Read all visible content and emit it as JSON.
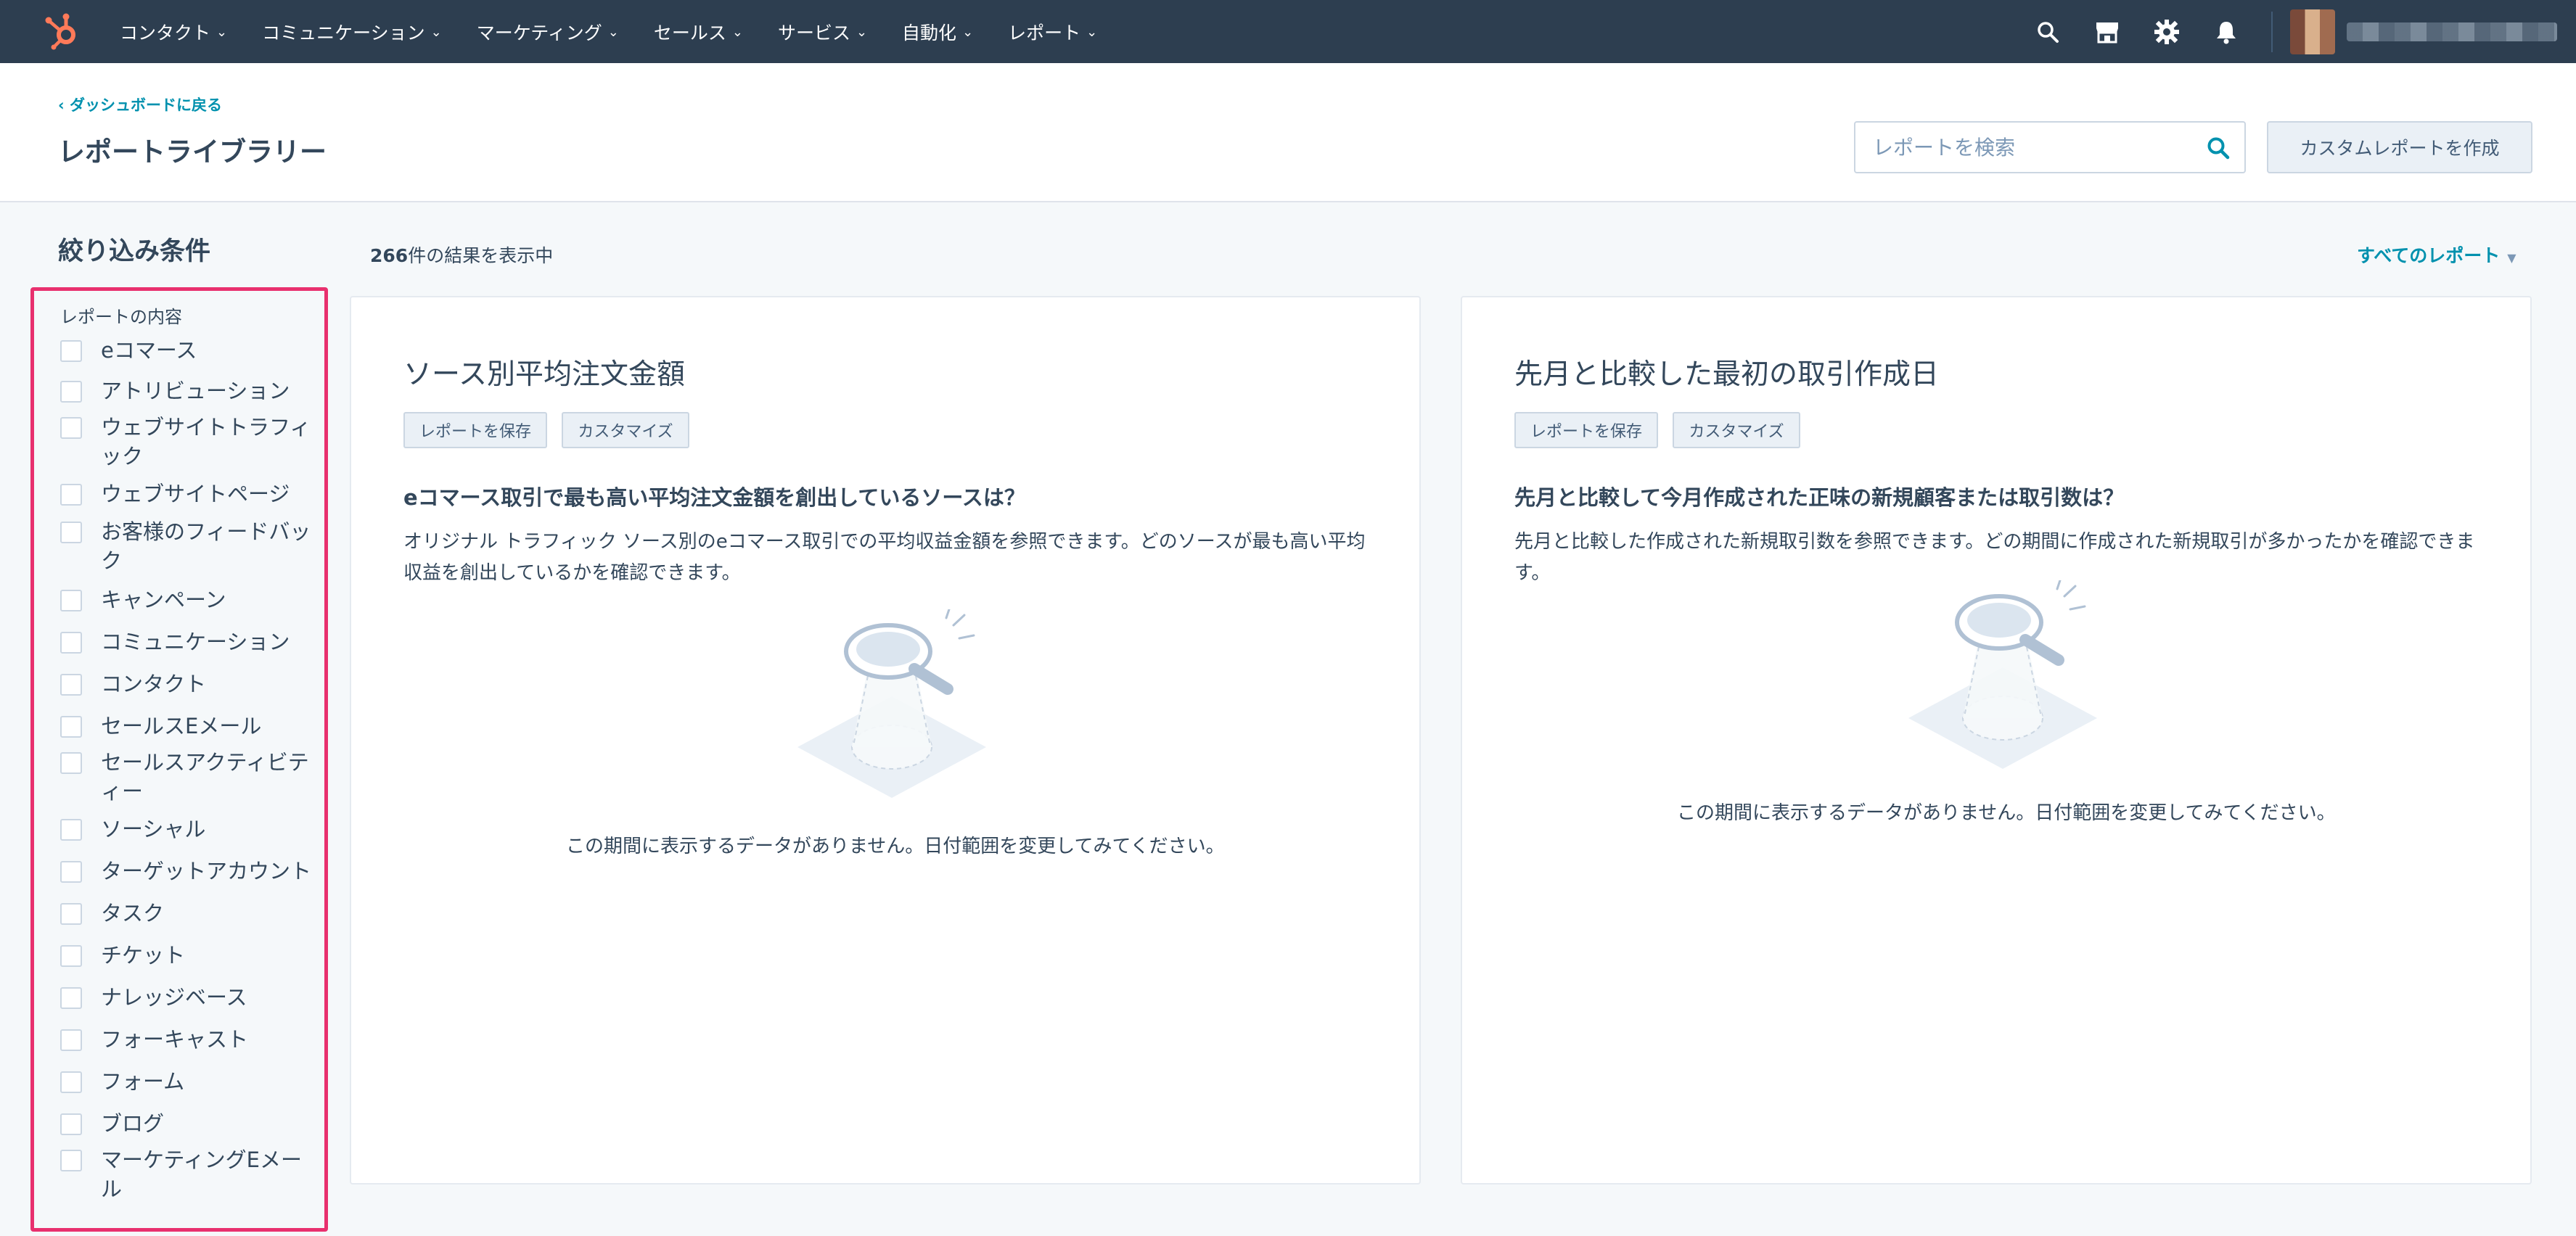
{
  "nav": {
    "items": [
      {
        "label": "コンタクト"
      },
      {
        "label": "コミュニケーション"
      },
      {
        "label": "マーケティング"
      },
      {
        "label": "セールス"
      },
      {
        "label": "サービス"
      },
      {
        "label": "自動化"
      },
      {
        "label": "レポート"
      }
    ],
    "icons": [
      "search-icon",
      "marketplace-icon",
      "gear-icon",
      "bell-icon"
    ]
  },
  "header": {
    "back_link": "ダッシュボードに戻る",
    "title": "レポートライブラリー",
    "search_placeholder": "レポートを検索",
    "create_button": "カスタムレポートを作成"
  },
  "filters": {
    "title": "絞り込み条件",
    "section_title": "レポートの内容",
    "items": [
      "eコマース",
      "アトリビューション",
      "ウェブサイトトラフィック",
      "ウェブサイトページ",
      "お客様のフィードバック",
      "キャンペーン",
      "コミュニケーション",
      "コンタクト",
      "セールスEメール",
      "セールスアクティビティー",
      "ソーシャル",
      "ターゲットアカウント",
      "タスク",
      "チケット",
      "ナレッジベース",
      "フォーキャスト",
      "フォーム",
      "ブログ",
      "マーケティングEメール"
    ]
  },
  "results": {
    "count": "266",
    "count_suffix": "件の結果を表示中",
    "all_reports": "すべてのレポート"
  },
  "cards": [
    {
      "title": "ソース別平均注文金額",
      "save_label": "レポートを保存",
      "customize_label": "カスタマイズ",
      "question": "eコマース取引で最も高い平均注文金額を創出しているソースは？",
      "description": "オリジナル トラフィック ソース別のeコマース取引での平均収益金額を参照できます。どのソースが最も高い平均収益を創出しているかを確認できます。",
      "empty_message": "この期間に表示するデータがありません。日付範囲を変更してみてください。"
    },
    {
      "title": "先月と比較した最初の取引作成日",
      "save_label": "レポートを保存",
      "customize_label": "カスタマイズ",
      "question": "先月と比較して今月作成された正味の新規顧客または取引数は？",
      "description": "先月と比較した作成された新規取引数を参照できます。どの期間に作成された新規取引が多かったかを確認できます。",
      "empty_message": "この期間に表示するデータがありません。日付範囲を変更してみてください。"
    }
  ],
  "colors": {
    "nav_bg": "#2d3e50",
    "accent": "#0091ae",
    "highlight_border": "#e8306e",
    "logo": "#ff7a59"
  }
}
